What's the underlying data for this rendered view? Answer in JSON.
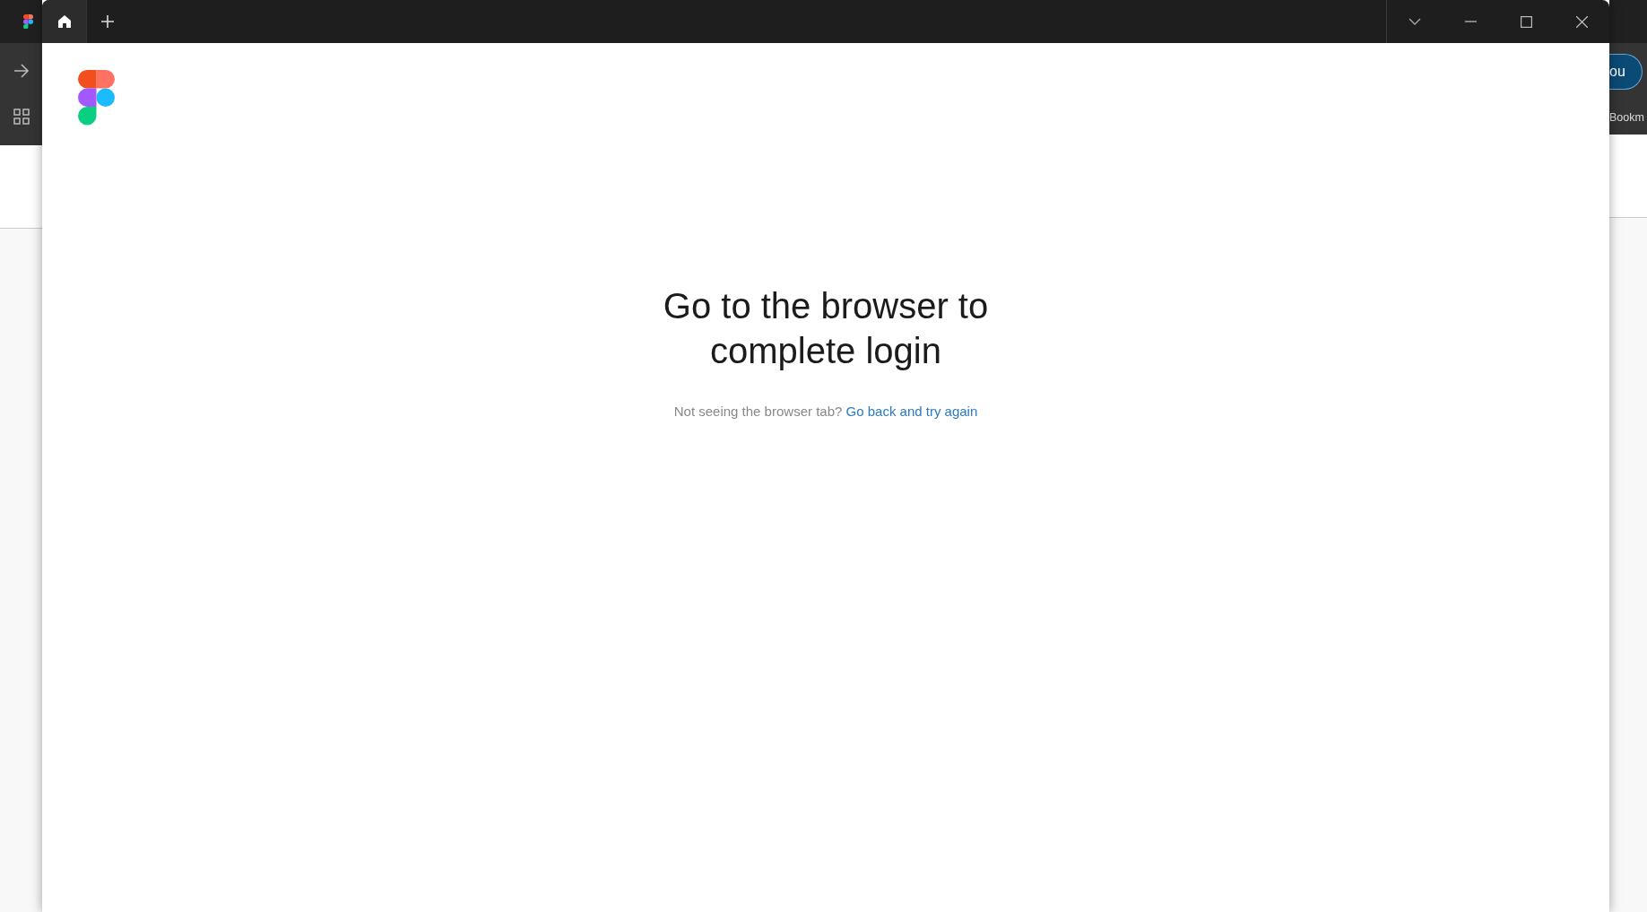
{
  "background_browser": {
    "profile_button": "ou",
    "bookmarks_label": "Bookm"
  },
  "window": {
    "tabs": [
      {
        "kind": "home",
        "selected": true
      }
    ]
  },
  "login": {
    "heading": "Go to the browser to complete login",
    "hint": "Not seeing the browser tab?",
    "link": "Go back and try again"
  }
}
